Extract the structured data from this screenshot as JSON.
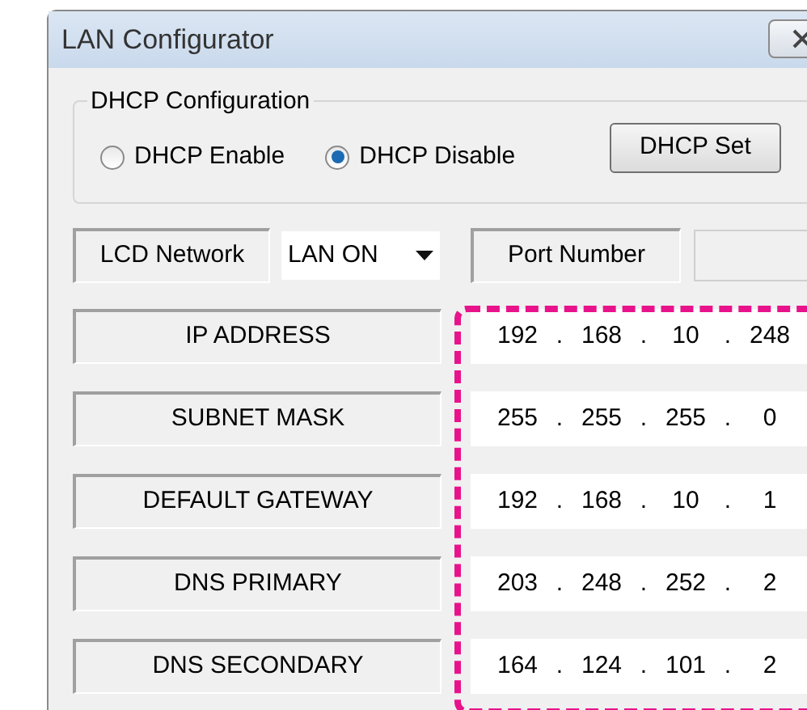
{
  "window": {
    "title": "LAN Configurator"
  },
  "dhcp": {
    "title": "DHCP Configuration",
    "options": [
      {
        "label": "DHCP Enable",
        "selected": false
      },
      {
        "label": "DHCP Disable",
        "selected": true
      }
    ],
    "button": "DHCP Set"
  },
  "network": {
    "label": "LCD Network",
    "dropdown": "LAN ON",
    "port_label": "Port Number"
  },
  "addresses": {
    "separator": ".",
    "rows": [
      {
        "label": "IP ADDRESS",
        "octets": [
          "192",
          "168",
          "10",
          "248"
        ]
      },
      {
        "label": "SUBNET MASK",
        "octets": [
          "255",
          "255",
          "255",
          "0"
        ]
      },
      {
        "label": "DEFAULT GATEWAY",
        "octets": [
          "192",
          "168",
          "10",
          "1"
        ]
      },
      {
        "label": "DNS PRIMARY",
        "octets": [
          "203",
          "248",
          "252",
          "2"
        ]
      },
      {
        "label": "DNS SECONDARY",
        "octets": [
          "164",
          "124",
          "101",
          "2"
        ]
      }
    ]
  }
}
